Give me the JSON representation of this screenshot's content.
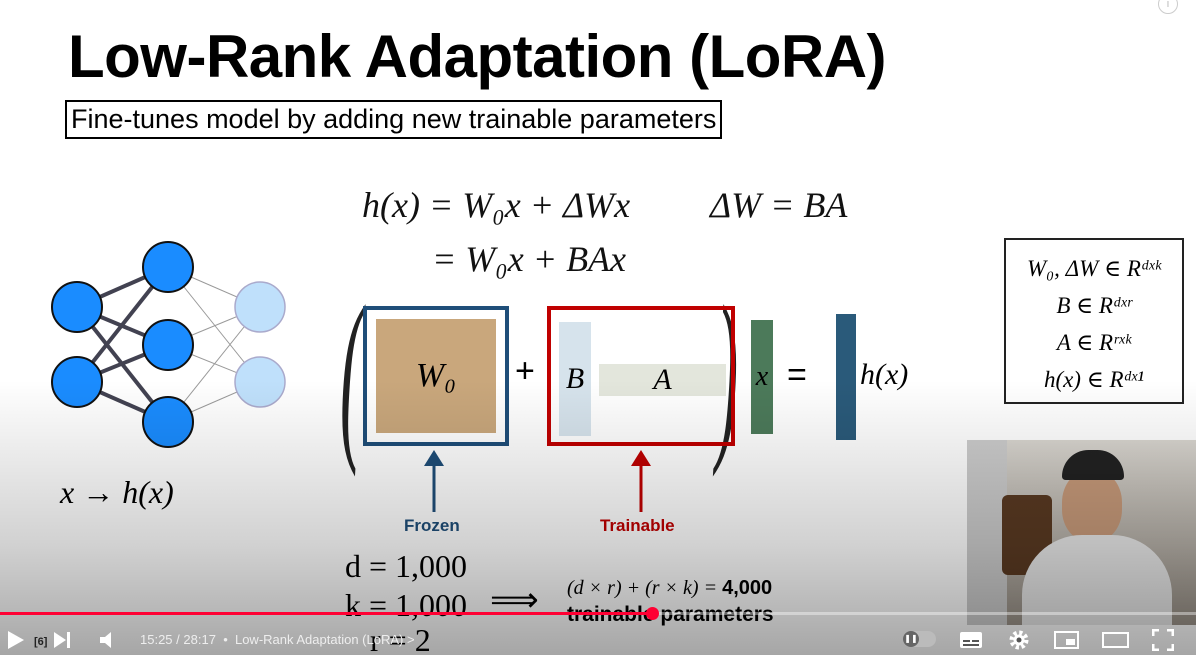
{
  "slide": {
    "title": "Low-Rank Adaptation (LoRA)",
    "subtitle": "Fine-tunes model by adding new trainable parameters",
    "eq1": "h(x) = W₀x + ΔWx",
    "eq2": "ΔW = BA",
    "eq3": "= W₀x + BAx",
    "nn_caption": "x → h(x)",
    "w0_label": "W₀",
    "plus": "+",
    "b_label": "B",
    "a_label": "A",
    "x_label": "x",
    "equals": "=",
    "hx_label": "h(x)",
    "frozen_label": "Frozen",
    "trainable_label": "Trainable",
    "dims": [
      "W₀, ΔW ∈ Rᵈˣᵏ",
      "B ∈ Rᵈˣʳ",
      "A ∈ Rʳˣᵏ",
      "h(x) ∈ Rᵈˣ¹"
    ],
    "d_eq": "d = 1,000",
    "k_eq": "k = 1,000",
    "r_eq": "r = 2",
    "implies": "⟹",
    "count_formula": "(d × r) + (r × k) = ",
    "count_value": "4,000",
    "count_caption": "trainable parameters",
    "colors": {
      "frozen": "#1f4e79",
      "trainable": "#c00000",
      "w0_fill": "#c9a77c",
      "b_fill": "#d6e3ec",
      "a_fill": "#e3e6dc",
      "x_fill": "#4c7a5a",
      "h_fill": "#2a5a7a",
      "node": "#1a8cff"
    }
  },
  "player": {
    "current_time": "15:25",
    "duration": "28:17",
    "time_separator": "/",
    "chapter": "Low-Rank Adaptation (LoRA)",
    "chapter_chevron": ">",
    "playlist_badge": "[6]",
    "progress": 0.545,
    "info_icon": "i"
  }
}
